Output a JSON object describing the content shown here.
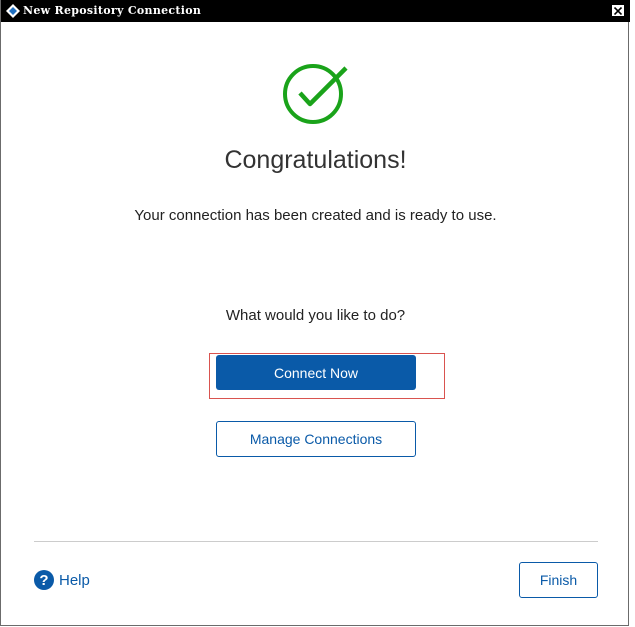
{
  "window": {
    "title": "New Repository Connection",
    "close_glyph": "✕",
    "icon": "app-diamond-icon"
  },
  "main": {
    "status_icon": "check-circle-icon",
    "heading": "Congratulations!",
    "message": "Your connection has been created and is ready to use.",
    "question": "What would you like to do?",
    "connect_now_label": "Connect Now",
    "manage_connections_label": "Manage Connections"
  },
  "footer": {
    "help_icon_glyph": "?",
    "help_label": "Help",
    "finish_label": "Finish"
  },
  "colors": {
    "primary": "#0a5aa8",
    "success": "#1aa31a",
    "highlight": "#d9534f",
    "titlebar": "#000000"
  }
}
